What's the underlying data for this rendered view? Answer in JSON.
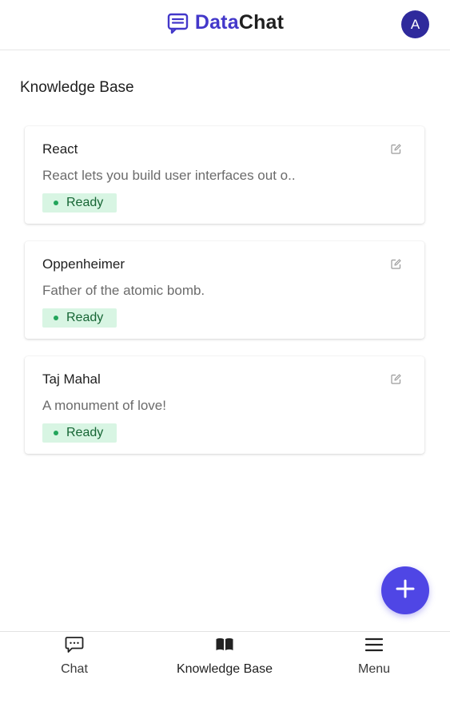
{
  "header": {
    "brand_part1": "Data",
    "brand_part2": "Chat",
    "avatar_initial": "A",
    "brand_color": "#4338ca",
    "avatar_color": "#2f2a9c"
  },
  "page": {
    "title": "Knowledge Base"
  },
  "cards": [
    {
      "title": "React",
      "description": "React lets you build user interfaces out o..",
      "status": "Ready"
    },
    {
      "title": "Oppenheimer",
      "description": "Father of the atomic bomb.",
      "status": "Ready"
    },
    {
      "title": "Taj Mahal",
      "description": "A monument of love!",
      "status": "Ready"
    }
  ],
  "fab": {
    "icon": "plus-icon",
    "color": "#4f46e5"
  },
  "bottom_nav": {
    "items": [
      {
        "label": "Chat",
        "icon": "chat-bubble-icon"
      },
      {
        "label": "Knowledge Base",
        "icon": "book-icon",
        "active": true
      },
      {
        "label": "Menu",
        "icon": "hamburger-menu-icon"
      }
    ]
  },
  "colors": {
    "status_bg": "#d8f5e3",
    "status_dot": "#22a55b",
    "status_text": "#166534"
  }
}
